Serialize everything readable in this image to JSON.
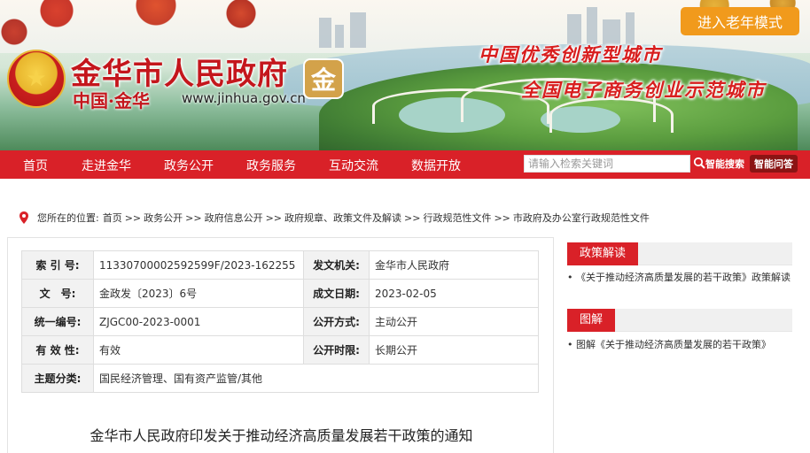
{
  "header": {
    "elder_mode_button": "进入老年模式",
    "site_name": "金华市人民政府",
    "site_sub": "中国·金华",
    "site_url": "www.jinhua.gov.cn",
    "slogan_1": "中国优秀创新型城市",
    "slogan_2": "全国电子商务创业示范城市",
    "seal_char": "金"
  },
  "nav": {
    "items": [
      "首页",
      "走进金华",
      "政务公开",
      "政务服务",
      "互动交流",
      "数据开放"
    ],
    "search_placeholder": "请输入检索关键词",
    "smart_search": "智能搜索",
    "smart_qa": "智能问答"
  },
  "breadcrumb": {
    "prefix": "您所在的位置:",
    "items": [
      "首页",
      "政务公开",
      "政府信息公开",
      "政府规章、政策文件及解读",
      "行政规范性文件",
      "市政府及办公室行政规范性文件"
    ],
    "separator": ">>"
  },
  "info_table": {
    "rows": [
      {
        "k1": "索 引 号:",
        "v1": "11330700002592599F/2023-162255",
        "k2": "发文机关:",
        "v2": "金华市人民政府"
      },
      {
        "k1": "文　号:",
        "v1": "金政发〔2023〕6号",
        "k2": "成文日期:",
        "v2": "2023-02-05"
      },
      {
        "k1": "统一编号:",
        "v1": "ZJGC00-2023-0001",
        "k2": "公开方式:",
        "v2": "主动公开"
      },
      {
        "k1": "有 效 性:",
        "v1": "有效",
        "k2": "公开时限:",
        "v2": "长期公开"
      }
    ],
    "subject_label": "主题分类:",
    "subject_value": "国民经济管理、国有资产监管/其他"
  },
  "document": {
    "title": "金华市人民政府印发关于推动经济高质量发展若干政策的通知"
  },
  "sidebar": {
    "section1_title": "政策解读",
    "section1_items": [
      "《关于推动经济高质量发展的若干政策》政策解读"
    ],
    "section2_title": "图解",
    "section2_items": [
      "图解《关于推动经济高质量发展的若干政策》"
    ]
  },
  "colors": {
    "primary_red": "#d92128",
    "elder_orange": "#f19a1c"
  }
}
